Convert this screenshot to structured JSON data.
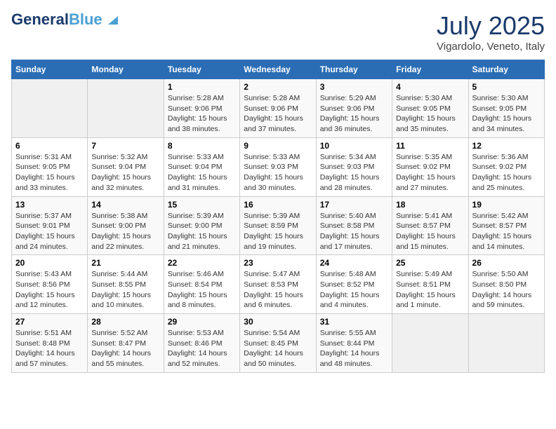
{
  "header": {
    "logo_line1": "General",
    "logo_line2": "Blue",
    "month": "July 2025",
    "location": "Vigardolo, Veneto, Italy"
  },
  "days_of_week": [
    "Sunday",
    "Monday",
    "Tuesday",
    "Wednesday",
    "Thursday",
    "Friday",
    "Saturday"
  ],
  "weeks": [
    [
      {
        "day": "",
        "detail": ""
      },
      {
        "day": "",
        "detail": ""
      },
      {
        "day": "1",
        "detail": "Sunrise: 5:28 AM\nSunset: 9:06 PM\nDaylight: 15 hours and 38 minutes."
      },
      {
        "day": "2",
        "detail": "Sunrise: 5:28 AM\nSunset: 9:06 PM\nDaylight: 15 hours and 37 minutes."
      },
      {
        "day": "3",
        "detail": "Sunrise: 5:29 AM\nSunset: 9:06 PM\nDaylight: 15 hours and 36 minutes."
      },
      {
        "day": "4",
        "detail": "Sunrise: 5:30 AM\nSunset: 9:05 PM\nDaylight: 15 hours and 35 minutes."
      },
      {
        "day": "5",
        "detail": "Sunrise: 5:30 AM\nSunset: 9:05 PM\nDaylight: 15 hours and 34 minutes."
      }
    ],
    [
      {
        "day": "6",
        "detail": "Sunrise: 5:31 AM\nSunset: 9:05 PM\nDaylight: 15 hours and 33 minutes."
      },
      {
        "day": "7",
        "detail": "Sunrise: 5:32 AM\nSunset: 9:04 PM\nDaylight: 15 hours and 32 minutes."
      },
      {
        "day": "8",
        "detail": "Sunrise: 5:33 AM\nSunset: 9:04 PM\nDaylight: 15 hours and 31 minutes."
      },
      {
        "day": "9",
        "detail": "Sunrise: 5:33 AM\nSunset: 9:03 PM\nDaylight: 15 hours and 30 minutes."
      },
      {
        "day": "10",
        "detail": "Sunrise: 5:34 AM\nSunset: 9:03 PM\nDaylight: 15 hours and 28 minutes."
      },
      {
        "day": "11",
        "detail": "Sunrise: 5:35 AM\nSunset: 9:02 PM\nDaylight: 15 hours and 27 minutes."
      },
      {
        "day": "12",
        "detail": "Sunrise: 5:36 AM\nSunset: 9:02 PM\nDaylight: 15 hours and 25 minutes."
      }
    ],
    [
      {
        "day": "13",
        "detail": "Sunrise: 5:37 AM\nSunset: 9:01 PM\nDaylight: 15 hours and 24 minutes."
      },
      {
        "day": "14",
        "detail": "Sunrise: 5:38 AM\nSunset: 9:00 PM\nDaylight: 15 hours and 22 minutes."
      },
      {
        "day": "15",
        "detail": "Sunrise: 5:39 AM\nSunset: 9:00 PM\nDaylight: 15 hours and 21 minutes."
      },
      {
        "day": "16",
        "detail": "Sunrise: 5:39 AM\nSunset: 8:59 PM\nDaylight: 15 hours and 19 minutes."
      },
      {
        "day": "17",
        "detail": "Sunrise: 5:40 AM\nSunset: 8:58 PM\nDaylight: 15 hours and 17 minutes."
      },
      {
        "day": "18",
        "detail": "Sunrise: 5:41 AM\nSunset: 8:57 PM\nDaylight: 15 hours and 15 minutes."
      },
      {
        "day": "19",
        "detail": "Sunrise: 5:42 AM\nSunset: 8:57 PM\nDaylight: 15 hours and 14 minutes."
      }
    ],
    [
      {
        "day": "20",
        "detail": "Sunrise: 5:43 AM\nSunset: 8:56 PM\nDaylight: 15 hours and 12 minutes."
      },
      {
        "day": "21",
        "detail": "Sunrise: 5:44 AM\nSunset: 8:55 PM\nDaylight: 15 hours and 10 minutes."
      },
      {
        "day": "22",
        "detail": "Sunrise: 5:46 AM\nSunset: 8:54 PM\nDaylight: 15 hours and 8 minutes."
      },
      {
        "day": "23",
        "detail": "Sunrise: 5:47 AM\nSunset: 8:53 PM\nDaylight: 15 hours and 6 minutes."
      },
      {
        "day": "24",
        "detail": "Sunrise: 5:48 AM\nSunset: 8:52 PM\nDaylight: 15 hours and 4 minutes."
      },
      {
        "day": "25",
        "detail": "Sunrise: 5:49 AM\nSunset: 8:51 PM\nDaylight: 15 hours and 1 minute."
      },
      {
        "day": "26",
        "detail": "Sunrise: 5:50 AM\nSunset: 8:50 PM\nDaylight: 14 hours and 59 minutes."
      }
    ],
    [
      {
        "day": "27",
        "detail": "Sunrise: 5:51 AM\nSunset: 8:48 PM\nDaylight: 14 hours and 57 minutes."
      },
      {
        "day": "28",
        "detail": "Sunrise: 5:52 AM\nSunset: 8:47 PM\nDaylight: 14 hours and 55 minutes."
      },
      {
        "day": "29",
        "detail": "Sunrise: 5:53 AM\nSunset: 8:46 PM\nDaylight: 14 hours and 52 minutes."
      },
      {
        "day": "30",
        "detail": "Sunrise: 5:54 AM\nSunset: 8:45 PM\nDaylight: 14 hours and 50 minutes."
      },
      {
        "day": "31",
        "detail": "Sunrise: 5:55 AM\nSunset: 8:44 PM\nDaylight: 14 hours and 48 minutes."
      },
      {
        "day": "",
        "detail": ""
      },
      {
        "day": "",
        "detail": ""
      }
    ]
  ]
}
